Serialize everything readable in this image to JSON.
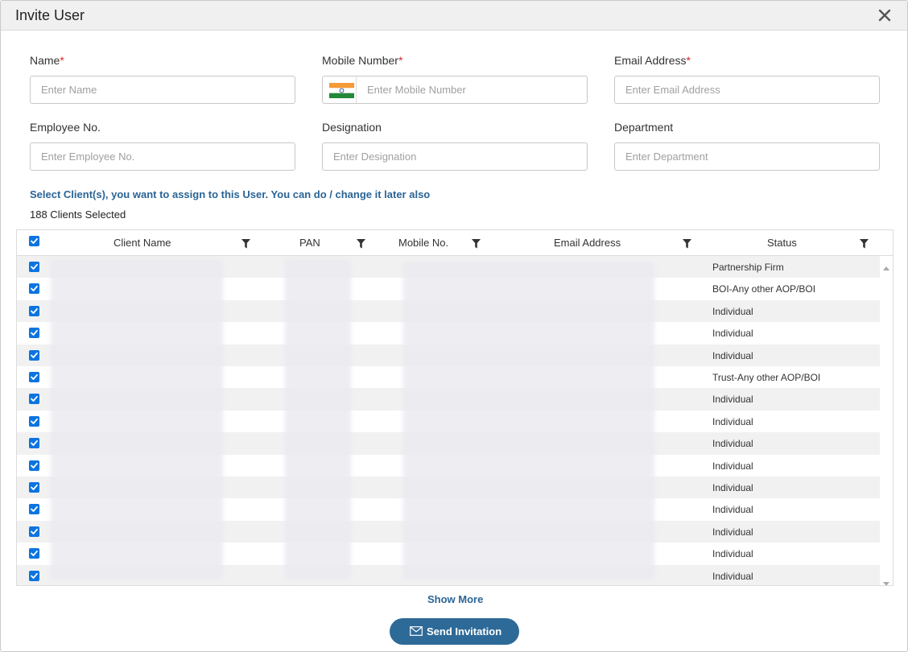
{
  "dialog": {
    "title": "Invite User"
  },
  "form": {
    "name": {
      "label": "Name",
      "required_mark": "*",
      "placeholder": "Enter Name",
      "value": ""
    },
    "mobile": {
      "label": "Mobile Number",
      "required_mark": "*",
      "placeholder": "Enter Mobile Number",
      "value": ""
    },
    "email": {
      "label": "Email Address",
      "required_mark": "*",
      "placeholder": "Enter Email Address",
      "value": ""
    },
    "employee_no": {
      "label": "Employee No.",
      "placeholder": "Enter Employee No.",
      "value": ""
    },
    "designation": {
      "label": "Designation",
      "placeholder": "Enter Designation",
      "value": ""
    },
    "department": {
      "label": "Department",
      "placeholder": "Enter Department",
      "value": ""
    }
  },
  "assign": {
    "instruction": "Select Client(s), you want to assign to this User. You can do / change it later also",
    "selected_count": "188 Clients Selected"
  },
  "table": {
    "columns": [
      "Client Name",
      "PAN",
      "Mobile No.",
      "Email Address",
      "Status"
    ],
    "rows": [
      {
        "checked": true,
        "status": "Partnership Firm"
      },
      {
        "checked": true,
        "status": "BOI-Any other AOP/BOI"
      },
      {
        "checked": true,
        "status": "Individual"
      },
      {
        "checked": true,
        "status": "Individual"
      },
      {
        "checked": true,
        "status": "Individual"
      },
      {
        "checked": true,
        "status": "Trust-Any other AOP/BOI"
      },
      {
        "checked": true,
        "status": "Individual"
      },
      {
        "checked": true,
        "status": "Individual"
      },
      {
        "checked": true,
        "status": "Individual"
      },
      {
        "checked": true,
        "status": "Individual"
      },
      {
        "checked": true,
        "status": "Individual"
      },
      {
        "checked": true,
        "status": "Individual"
      },
      {
        "checked": true,
        "status": "Individual"
      },
      {
        "checked": true,
        "status": "Individual"
      },
      {
        "checked": true,
        "status": "Individual"
      }
    ]
  },
  "actions": {
    "show_more": "Show More",
    "send_invitation": "Send Invitation"
  },
  "colors": {
    "accent": "#2e6a98",
    "link": "#2a6496",
    "checkbox": "#0b74e0",
    "required": "#d9262b"
  },
  "icons": [
    "close-icon",
    "india-flag-icon",
    "filter-icon",
    "checkbox-checked-icon",
    "scroll-up-icon",
    "scroll-down-icon",
    "mail-icon"
  ]
}
